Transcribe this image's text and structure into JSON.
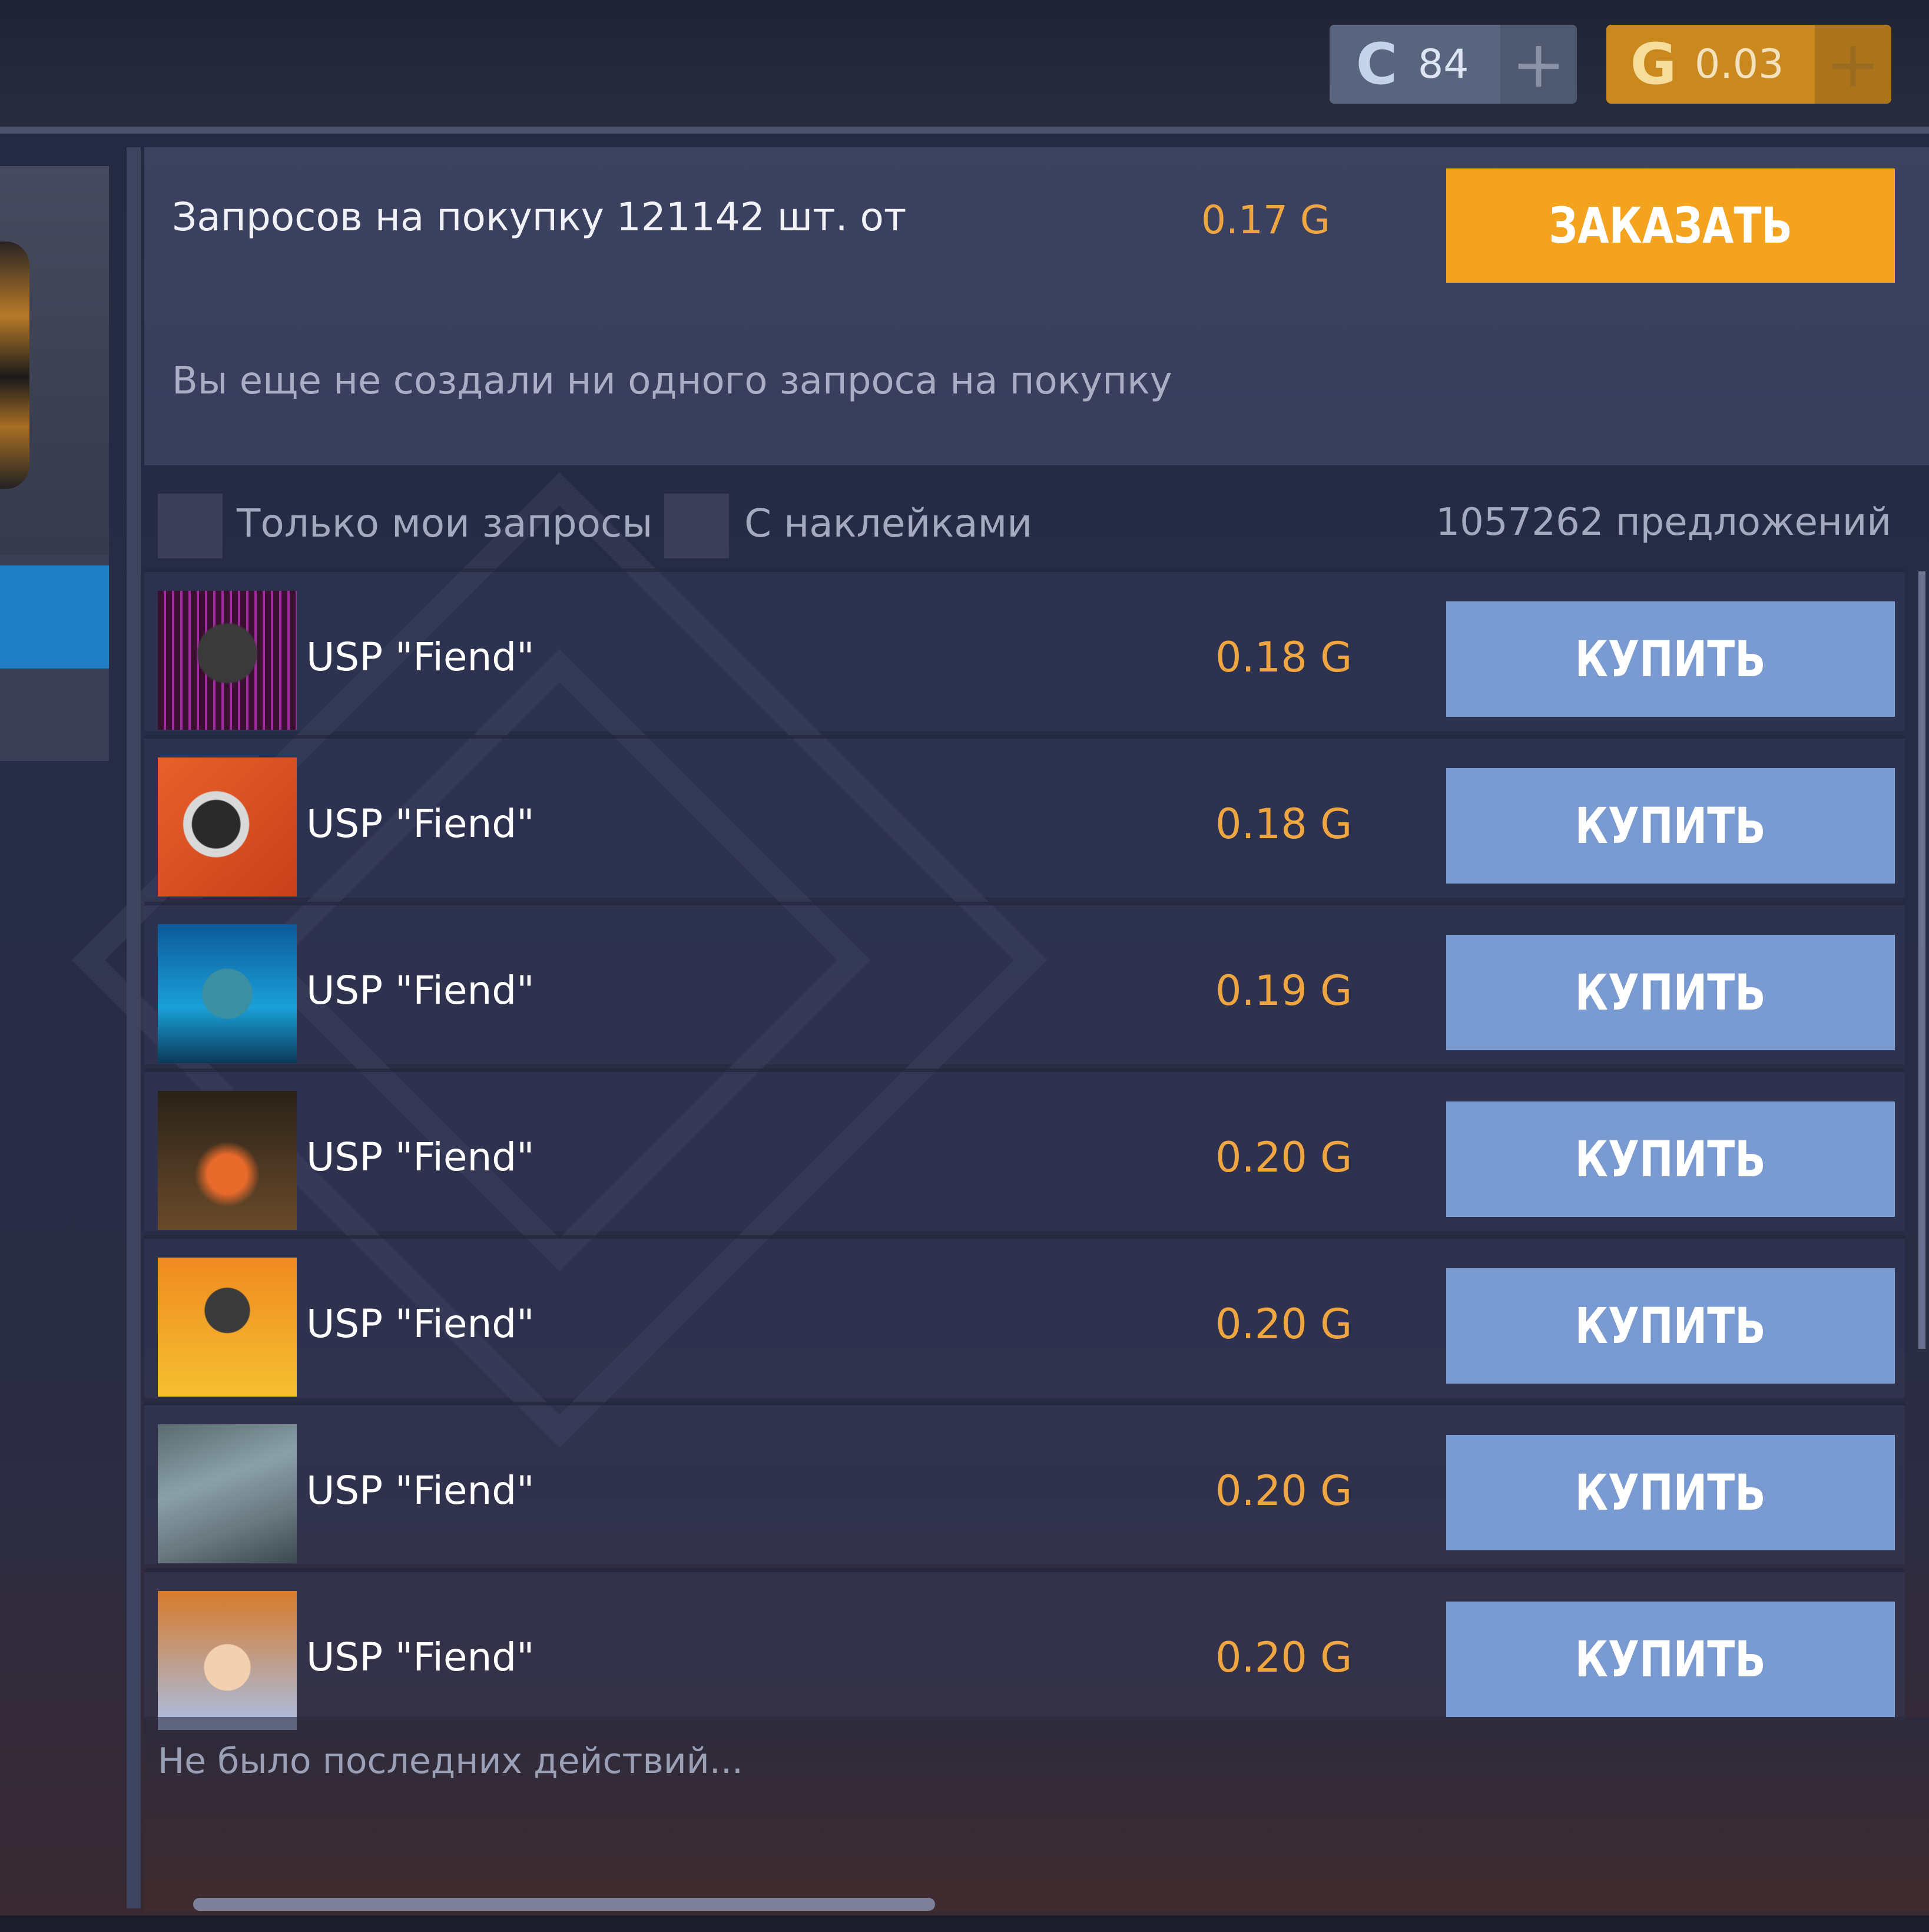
{
  "currency": {
    "credits": {
      "icon": "credits-c-icon",
      "glyph": "C",
      "value": "84",
      "add": "+"
    },
    "gold": {
      "icon": "gold-g-icon",
      "glyph": "G",
      "value": "0.03",
      "add": "+"
    }
  },
  "request": {
    "summary": "Запросов на покупку 121142 шт. от",
    "price": "0.17 G",
    "order_label": "ЗАКАЗАТЬ",
    "empty_message": "Вы еще не создали ни одного запроса на покупку"
  },
  "filters": {
    "only_mine": "Только мои запросы",
    "with_stickers": "С наклейками",
    "offers_count": "1057262 предложений"
  },
  "listings": [
    {
      "name": "USP \"Fiend\"",
      "price": "0.18 G",
      "buy": "КУПИТЬ",
      "avatar": "soldier-avatar-icon"
    },
    {
      "name": "USP \"Fiend\"",
      "price": "0.18 G",
      "buy": "КУПИТЬ",
      "avatar": "masked-hero-avatar-icon"
    },
    {
      "name": "USP \"Fiend\"",
      "price": "0.19 G",
      "buy": "КУПИТЬ",
      "avatar": "dagger-logo-avatar-icon"
    },
    {
      "name": "USP \"Fiend\"",
      "price": "0.20 G",
      "buy": "КУПИТЬ",
      "avatar": "m-logo-avatar-icon"
    },
    {
      "name": "USP \"Fiend\"",
      "price": "0.20 G",
      "buy": "КУПИТЬ",
      "avatar": "fire-mask-avatar-icon"
    },
    {
      "name": "USP \"Fiend\"",
      "price": "0.20 G",
      "buy": "КУПИТЬ",
      "avatar": "landscape-avatar-icon"
    },
    {
      "name": "USP \"Fiend\"",
      "price": "0.20 G",
      "buy": "КУПИТЬ",
      "avatar": "hearts-avatar-icon"
    }
  ],
  "log": {
    "message": "Не было последних действий..."
  },
  "colors": {
    "accent_orange": "#f3a31d",
    "buy_blue": "#7a9bd2",
    "price_orange": "#f0a640"
  }
}
